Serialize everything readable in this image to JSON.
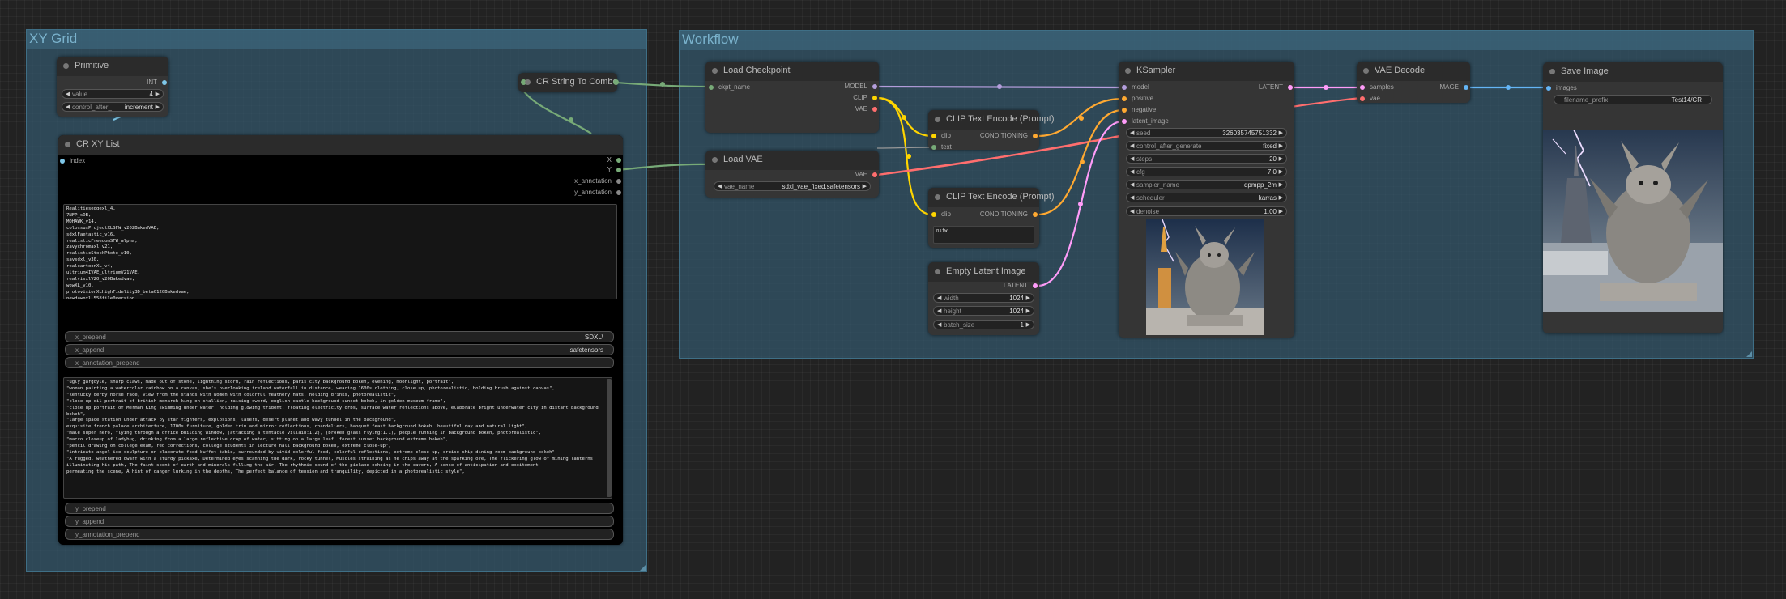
{
  "groups": {
    "xy_grid": "XY Grid",
    "workflow": "Workflow"
  },
  "primitive": {
    "title": "Primitive",
    "output": "INT",
    "value_label": "value",
    "value": "4",
    "control_label": "control_after_",
    "control_value": "increment"
  },
  "cr_string_to_combo": {
    "title": "CR String To Combo"
  },
  "cr_xy_list": {
    "title": "CR XY List",
    "input_index": "index",
    "outputs": [
      "X",
      "Y",
      "x_annotation",
      "y_annotation"
    ],
    "x_text": "Realitiesedgexl_4,\n7NFP_sDB,\nMOHAWK_v14,\ncolossusProjectXLSFW_v202BakedVAE,\nsdxlFaetastic_v16,\nrealisticFreedomSFW_alpha,\nzavychromaxl_v21,\nrealisticStockPhoto_v10,\nsavsdxl_v30,\nrealcartoonXL_v4,\nultrium4IVAE_ultriumV21VAE,\nrealvisxlV20_v20Bakedvae,\nwowXL_v10,\nprotovisionXLHighFidelity3D_beta0120Bakedvae,\nnewdawnxl_558file0version,\njuggernautXL_version3,\nShelalosProject_v11,",
    "x_prepend_label": "x_prepend",
    "x_prepend_value": "SDXL\\",
    "x_append_label": "x_append",
    "x_append_value": ".safetensors",
    "x_annotation_prepend_label": "x_annotation_prepend",
    "y_text": "\"ugly gargoyle, sharp claws, made out of stone, lightning storm, rain reflections, paris city background bokeh, evening, moonlight, portrait\",\n\"woman painting a watercolor rainbow on a canvas, she's overlooking ireland waterfall in distance, wearing 1600s clothing, close up, photorealistic, holding brush against canvas\",\n\"kentucky derby horse race, view from the stands with women with colorful feathery hats, holding drinks, photorealistic\",\n\"close up oil portrait of british monarch king on stallion, raising sword, english castle background sunset bokeh, in golden museum frame\",\n\"close up portrait of Merman King swimming under water, holding glowing trident, floating electricity orbs, surface water reflections above, elaborate bright underwater city in distant background bokeh\",\n\"large space station under attack by star fighters, explosions, lasers, desert planet and wavy tunnel in the background\",\nexquisite french palace architecture, 1700s furniture, golden trim and mirror reflections, chandeliers, banquet feast background bokeh, beautiful day and natural light\",\n\"male super hero, flying through a office building window, (attacking a tentacle villain:1.2), (broken glass flying:1.1), people running in background bokeh, photorealistic\",\n\"macro closeup of ladybug, drinking from a large reflective drop of water, sitting on a large leaf, forest sunset background extreme bokeh\",\n\"pencil drawing on college exam, red corrections, college students in lecture hall background bokeh, extreme close-up\",\n\"intricate angel ice sculpture on elaborate food buffet table, surrounded by vivid colorful food, colorful reflections, extreme close-up, cruise ship dining room background bokeh\",\n\"A rugged, weathered dwarf with a sturdy pickaxe, Determined eyes scanning the dark, rocky tunnel, Muscles straining as he chips away at the sparking ore, The flickering glow of mining lanterns illuminating his path, The faint scent of earth and minerals filling the air, The rhythmic sound of the pickaxe echoing in the cavern, A sense of anticipation and excitement\npermeating the scene, A hint of danger lurking in the depths, The perfect balance of tension and tranquility, depicted in a photorealistic style\",",
    "y_prepend_label": "y_prepend",
    "y_append_label": "y_append",
    "y_annotation_prepend_label": "y_annotation_prepend"
  },
  "load_checkpoint": {
    "title": "Load Checkpoint",
    "input": "ckpt_name",
    "outputs": [
      "MODEL",
      "CLIP",
      "VAE"
    ]
  },
  "load_vae": {
    "title": "Load VAE",
    "output": "VAE",
    "vae_label": "vae_name",
    "vae_value": "sdxl_vae_fixed.safetensors"
  },
  "clip_pos": {
    "title": "CLIP Text Encode (Prompt)",
    "inputs": [
      "clip",
      "text"
    ],
    "output": "CONDITIONING"
  },
  "clip_neg": {
    "title": "CLIP Text Encode (Prompt)",
    "input": "clip",
    "output": "CONDITIONING",
    "text": "nsfw"
  },
  "empty_latent": {
    "title": "Empty Latent Image",
    "output": "LATENT",
    "widgets": [
      {
        "label": "width",
        "value": "1024"
      },
      {
        "label": "height",
        "value": "1024"
      },
      {
        "label": "batch_size",
        "value": "1"
      }
    ]
  },
  "ksampler": {
    "title": "KSampler",
    "inputs": [
      "model",
      "positive",
      "negative",
      "latent_image"
    ],
    "output": "LATENT",
    "widgets": [
      {
        "label": "seed",
        "value": "326035745751332"
      },
      {
        "label": "control_after_generate",
        "value": "fixed"
      },
      {
        "label": "steps",
        "value": "20"
      },
      {
        "label": "cfg",
        "value": "7.0"
      },
      {
        "label": "sampler_name",
        "value": "dpmpp_2m"
      },
      {
        "label": "scheduler",
        "value": "karras"
      },
      {
        "label": "denoise",
        "value": "1.00"
      }
    ]
  },
  "vae_decode": {
    "title": "VAE Decode",
    "inputs": [
      "samples",
      "vae"
    ],
    "output": "IMAGE"
  },
  "save_image": {
    "title": "Save Image",
    "input": "images",
    "prefix_label": "filename_prefix",
    "prefix_value": "Test14/CR"
  },
  "colors": {
    "model": "#b39ddb",
    "clip": "#ffd500",
    "vae": "#ff6e6e",
    "conditioning": "#ffa931",
    "latent": "#ff9cf9",
    "image": "#64b5f6",
    "string": "#77aa77",
    "int": "#7ec7e8"
  }
}
